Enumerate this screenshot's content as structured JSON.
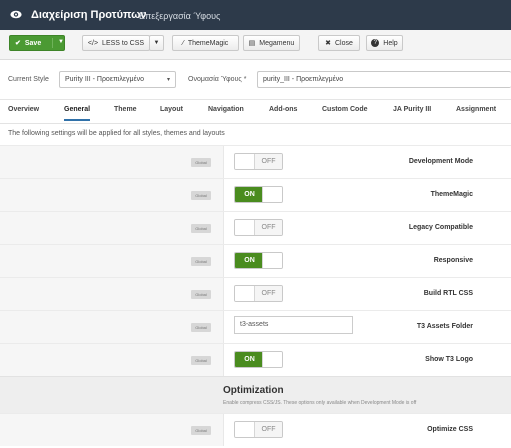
{
  "header": {
    "title": "Διαχείριση Προτύπων",
    "subtitle": "Επεξεργασία Ύφους",
    "icon": "eye-icon"
  },
  "toolbar": {
    "save_label": "Save",
    "less_label": "LESS to CSS",
    "thememagic_label": "ThemeMagic",
    "megamenu_label": "Megamenu",
    "close_label": "Close",
    "help_label": "Help",
    "save_color": "#4b9a33"
  },
  "style_bar": {
    "current_style_label": "Current Style",
    "current_style_value": "Purity III - Προεπιλεγμένο",
    "style_name_label": "Ονομασία Ύφους *",
    "style_name_value": "purity_III - Προεπιλεγμένο"
  },
  "tabs": [
    {
      "label": "Overview"
    },
    {
      "label": "General",
      "active": true
    },
    {
      "label": "Theme"
    },
    {
      "label": "Layout"
    },
    {
      "label": "Navigation"
    },
    {
      "label": "Add-ons"
    },
    {
      "label": "Custom Code"
    },
    {
      "label": "JA Purity III"
    },
    {
      "label": "Assignment"
    }
  ],
  "notice": "The following settings will be applied for all styles, themes and layouts",
  "badge_label": "Global",
  "on_label": "ON",
  "off_label": "OFF",
  "on_color": "#4a8c1f",
  "settings": {
    "development_mode": {
      "label": "Development Mode",
      "value": "OFF"
    },
    "thememagic": {
      "label": "ThemeMagic",
      "value": "ON"
    },
    "legacy_compatible": {
      "label": "Legacy Compatible",
      "value": "OFF"
    },
    "responsive": {
      "label": "Responsive",
      "value": "ON"
    },
    "build_rtl_css": {
      "label": "Build RTL CSS",
      "value": "OFF"
    },
    "t3_assets_folder": {
      "label": "T3 Assets Folder",
      "value": "t3-assets"
    },
    "show_t3_logo": {
      "label": "Show T3 Logo",
      "value": "ON"
    }
  },
  "optimization": {
    "heading": "Optimization",
    "description": "Enable compress CSS/JS. These options only available when Development Mode is off",
    "optimize_css": {
      "label": "Optimize CSS",
      "value": "OFF"
    }
  }
}
